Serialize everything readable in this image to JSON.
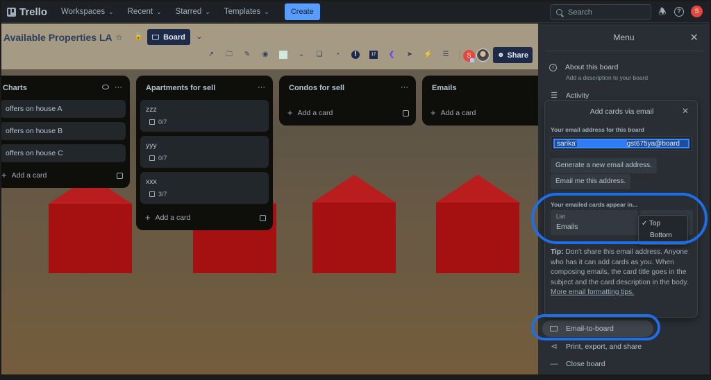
{
  "topnav": {
    "brand": "Trello",
    "items": [
      {
        "label": "Workspaces"
      },
      {
        "label": "Recent"
      },
      {
        "label": "Starred"
      },
      {
        "label": "Templates"
      }
    ],
    "create_label": "Create",
    "search_placeholder": "Search",
    "icons": [
      "notifications-icon",
      "help-icon"
    ],
    "user_initial": "S"
  },
  "board": {
    "title": "Available Properties LA",
    "view_label": "Board",
    "share_label": "Share",
    "member_initial": "S",
    "toolbar_icons": [
      "external-link-icon",
      "folder-icon",
      "pen-icon",
      "github-icon",
      "colorful-app-icon",
      "chevron-down-icon",
      "cards-icon",
      "chart-icon",
      "alert-icon",
      "calendar-icon",
      "purple-app-icon",
      "send-icon",
      "automation-icon",
      "filter-icon"
    ],
    "lists": [
      {
        "title": "Charts",
        "watched": true,
        "cards": [
          {
            "title": "offers on house A"
          },
          {
            "title": "offers on house B"
          },
          {
            "title": "offers on house C"
          }
        ],
        "add_label": "Add a card"
      },
      {
        "title": "Apartments for sell",
        "cards": [
          {
            "title": "zzz",
            "checklist": "0/7"
          },
          {
            "title": "yyy",
            "checklist": "0/7"
          },
          {
            "title": "xxx",
            "checklist": "3/7"
          }
        ],
        "add_label": "Add a card"
      },
      {
        "title": "Condos for sell",
        "cards": [],
        "add_label": "Add a card"
      },
      {
        "title": "Emails",
        "cards": [],
        "add_label": "Add a card"
      }
    ]
  },
  "menu": {
    "title": "Menu",
    "items": [
      {
        "label": "About this board",
        "sublabel": "Add a description to your board",
        "icon": "info-icon"
      },
      {
        "label": "Activity",
        "icon": "activity-icon"
      },
      {
        "label": "Email-to-board",
        "icon": "mail-icon"
      },
      {
        "label": "Print, export, and share",
        "icon": "share-icon"
      },
      {
        "label": "Close board",
        "icon": "minus-icon"
      }
    ]
  },
  "popover": {
    "title": "Add cards via email",
    "address_label": "Your email address for this board",
    "address_prefix": "sarika'",
    "address_suffix": "gst675ya@board",
    "generate_label": "Generate a new email address.",
    "email_me_label": "Email me this address.",
    "appear_label": "Your emailed cards appear in...",
    "list_field_label": "List",
    "list_field_value": "Emails",
    "position_options": [
      {
        "label": "Top",
        "selected": true
      },
      {
        "label": "Bottom",
        "selected": false
      }
    ],
    "tip_bold": "Tip:",
    "tip_text": " Don't share this email address. Anyone who has it can add cards as you. When composing emails, the card title goes in the subject and the card description in the body. ",
    "tip_link": "More email formatting tips."
  },
  "colors": {
    "accent": "#579dff",
    "annotation": "#1f6ee6",
    "avatar": "#e2483d"
  }
}
